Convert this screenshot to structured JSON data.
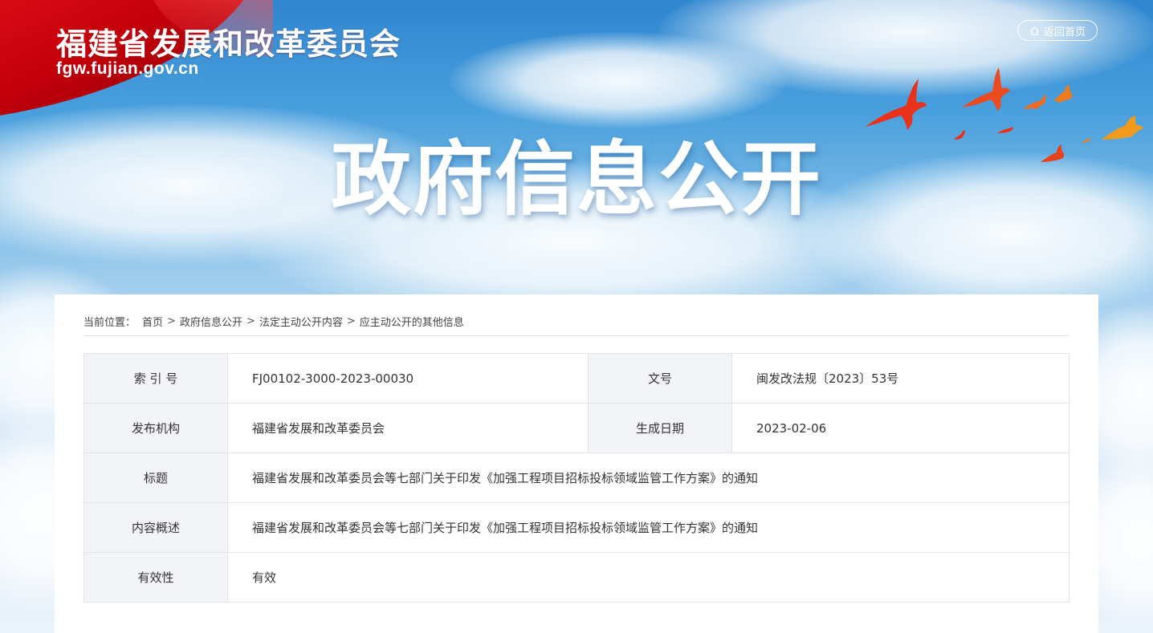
{
  "header": {
    "site_title": "福建省发展和改革委员会",
    "site_domain": "fgw.fujian.gov.cn",
    "home_button_label": "返回首页",
    "home_icon": "home-icon"
  },
  "banner": {
    "heading": "政府信息公开"
  },
  "breadcrumb": {
    "prefix": "当前位置：",
    "items": [
      "首页",
      "政府信息公开",
      "法定主动公开内容",
      "应主动公开的其他信息"
    ],
    "separator": ">"
  },
  "info": {
    "index_no_label": "索 引 号",
    "index_no_value": "FJ00102-3000-2023-00030",
    "doc_no_label": "文号",
    "doc_no_value": "闽发改法规〔2023〕53号",
    "publisher_label": "发布机构",
    "publisher_value": "福建省发展和改革委员会",
    "date_label": "生成日期",
    "date_value": "2023-02-06",
    "title_label": "标题",
    "title_value": "福建省发展和改革委员会等七部门关于印发《加强工程项目招标投标领域监管工作方案》的通知",
    "summary_label": "内容概述",
    "summary_value": "福建省发展和改革委员会等七部门关于印发《加强工程项目招标投标领域监管工作方案》的通知",
    "validity_label": "有效性",
    "validity_value": "有效"
  },
  "colors": {
    "flag_red": "#d0000d",
    "sky_blue": "#4aa0dd",
    "label_bg": "#f3f4f7",
    "bird_red": "#e8321c",
    "bird_orange": "#f08a1c"
  }
}
